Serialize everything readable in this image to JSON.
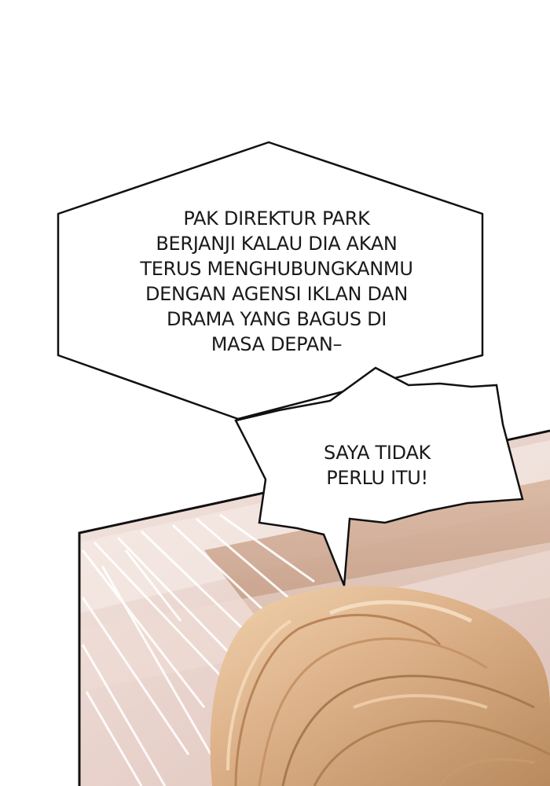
{
  "speech_bubble": {
    "lines": [
      "PAK DIREKTUR PARK",
      "BERJANJI KALAU DIA AKAN",
      "TERUS MENGHUBUNGKANMU",
      "DENGAN AGENSI IKLAN DAN",
      "DRAMA YANG BAGUS DI",
      "MASA DEPAN–"
    ]
  },
  "shout_bubble": {
    "lines": [
      "SAYA TIDAK",
      "PERLU ITU!"
    ]
  },
  "colors": {
    "background": "#ffffff",
    "bubble_fill": "#ffffff",
    "bubble_stroke": "#111111",
    "panel_wall": "#e6cfc7",
    "panel_beam": "#c9a590",
    "hair_light": "#e8c39c",
    "hair_mid": "#d2a57a",
    "hair_dark": "#b78658"
  }
}
